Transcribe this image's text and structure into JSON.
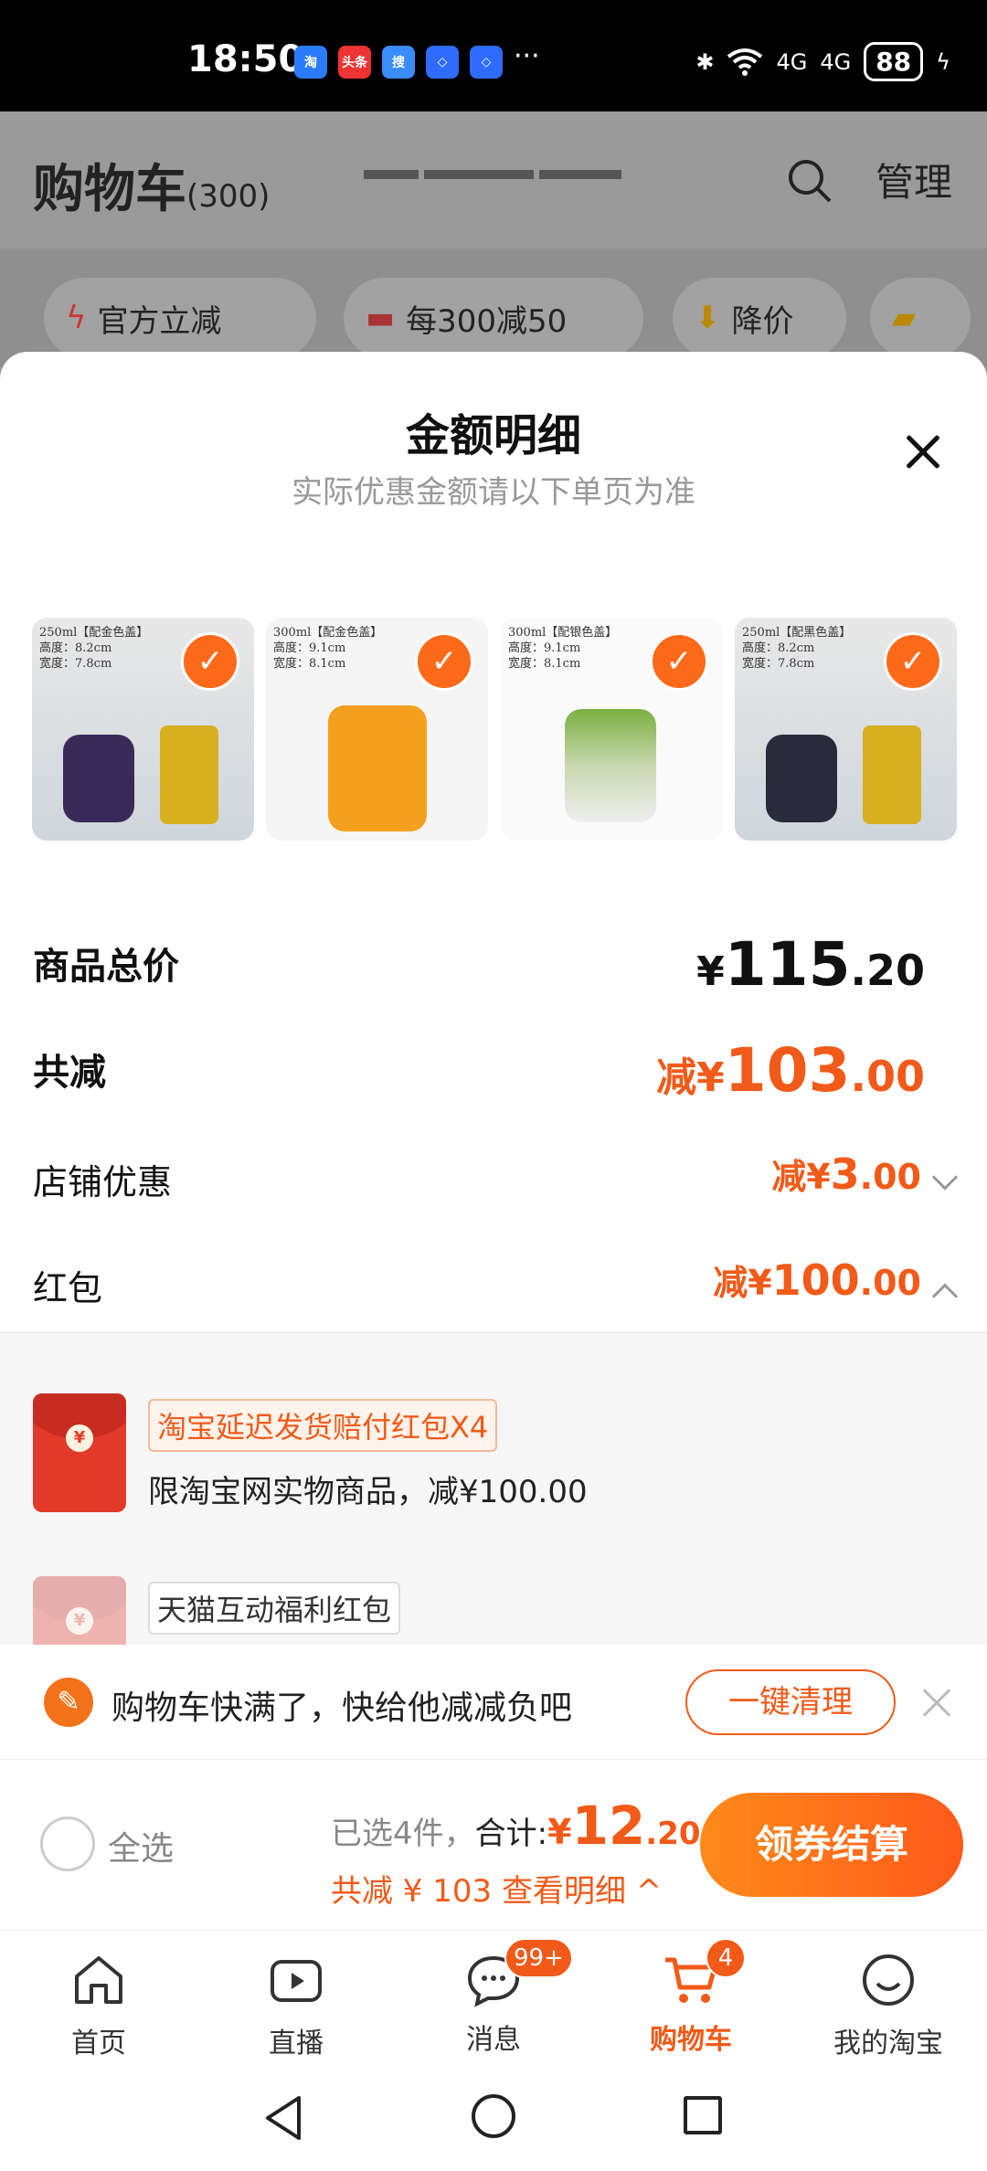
{
  "status_bar": {
    "time": "18:50",
    "app_icons": [
      "淘",
      "头条",
      "搜",
      "◇",
      "◇"
    ],
    "more": "···",
    "signal1": "4G",
    "signal2": "4G",
    "battery": "88"
  },
  "background_page": {
    "title": "购物车",
    "count": "(300)",
    "manage": "管理",
    "chips": [
      "官方立减",
      "每300减50",
      "降价"
    ]
  },
  "sheet": {
    "title": "金额明细",
    "subtitle": "实际优惠金额请以下单页为准",
    "products": [
      {
        "caption": "250ml【配金色盖】\n高度：8.2cm\n宽度：7.8cm"
      },
      {
        "caption": "300ml【配金色盖】\n高度：9.1cm\n宽度：8.1cm"
      },
      {
        "caption": "300ml【配银色盖】\n高度：9.1cm\n宽度：8.1cm"
      },
      {
        "caption": "250ml【配黑色盖】\n高度：8.2cm\n宽度：7.8cm"
      }
    ],
    "total": {
      "label": "商品总价",
      "currency": "¥",
      "int": "115",
      "dec": ".20"
    },
    "discount": {
      "label": "共减",
      "prefix": "减¥",
      "int": "103",
      "dec": ".00"
    },
    "shop_discount": {
      "label": "店铺优惠",
      "prefix": "减¥",
      "int": "3",
      "dec": ".00"
    },
    "red_packet": {
      "label": "红包",
      "prefix": "减¥",
      "int": "100",
      "dec": ".00"
    },
    "coupons": [
      {
        "tag": "淘宝延迟发货赔付红包X4",
        "desc": "限淘宝网实物商品，减¥100.00"
      },
      {
        "tag": "天猫互动福利红包",
        "desc": ""
      }
    ]
  },
  "notice": {
    "text": "购物车快满了，快给他减减负吧",
    "button": "一键清理"
  },
  "checkout": {
    "select_all": "全选",
    "selected": "已选4件，",
    "total_label": "合计:",
    "total_currency": "¥",
    "total_int": "12",
    "total_dec": ".20",
    "saved": "共减 ¥ 103",
    "detail_link": "查看明细 ^",
    "button": "领券结算"
  },
  "tabbar": {
    "tabs": [
      {
        "label": "首页",
        "icon": "home-icon"
      },
      {
        "label": "直播",
        "icon": "live-icon"
      },
      {
        "label": "消息",
        "icon": "message-icon",
        "badge": "99+"
      },
      {
        "label": "购物车",
        "icon": "cart-icon",
        "badge": "4",
        "active": true
      },
      {
        "label": "我的淘宝",
        "icon": "profile-icon"
      }
    ]
  },
  "colors": {
    "accent": "#f15a19",
    "checkout_gradient_start": "#ff8a1a"
  }
}
